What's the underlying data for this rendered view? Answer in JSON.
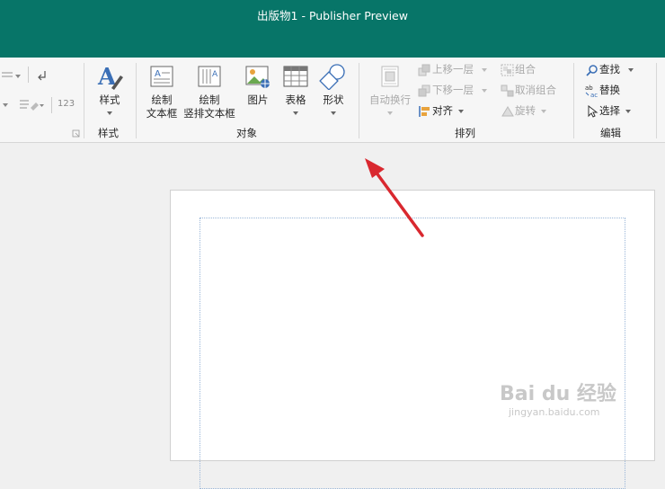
{
  "window": {
    "title": "出版物1  -  Publisher Preview"
  },
  "ribbon": {
    "styles": {
      "button": "样式",
      "group": "样式"
    },
    "objects": {
      "draw_textbox": [
        "绘制",
        "文本框"
      ],
      "draw_vertical_textbox": [
        "绘制",
        "竖排文本框"
      ],
      "picture": "图片",
      "table": "表格",
      "shapes": "形状",
      "group": "对象"
    },
    "arrange": {
      "wrap_text": "自动换行",
      "bring_forward": "上移一层",
      "send_backward": "下移一层",
      "align": "对齐",
      "group_btn": "组合",
      "ungroup": "取消组合",
      "rotate": "旋转",
      "group": "排列"
    },
    "editing": {
      "find": "查找",
      "replace": "替换",
      "select": "选择",
      "group": "编辑"
    },
    "left_partial": {
      "numbering": "123"
    }
  },
  "watermark": {
    "logo": "Bai du 经验",
    "url": "jingyan.baidu.com"
  },
  "colors": {
    "titlebar": "#077568",
    "arrow": "#d9282f",
    "ribbon": "#f6f6f6"
  }
}
